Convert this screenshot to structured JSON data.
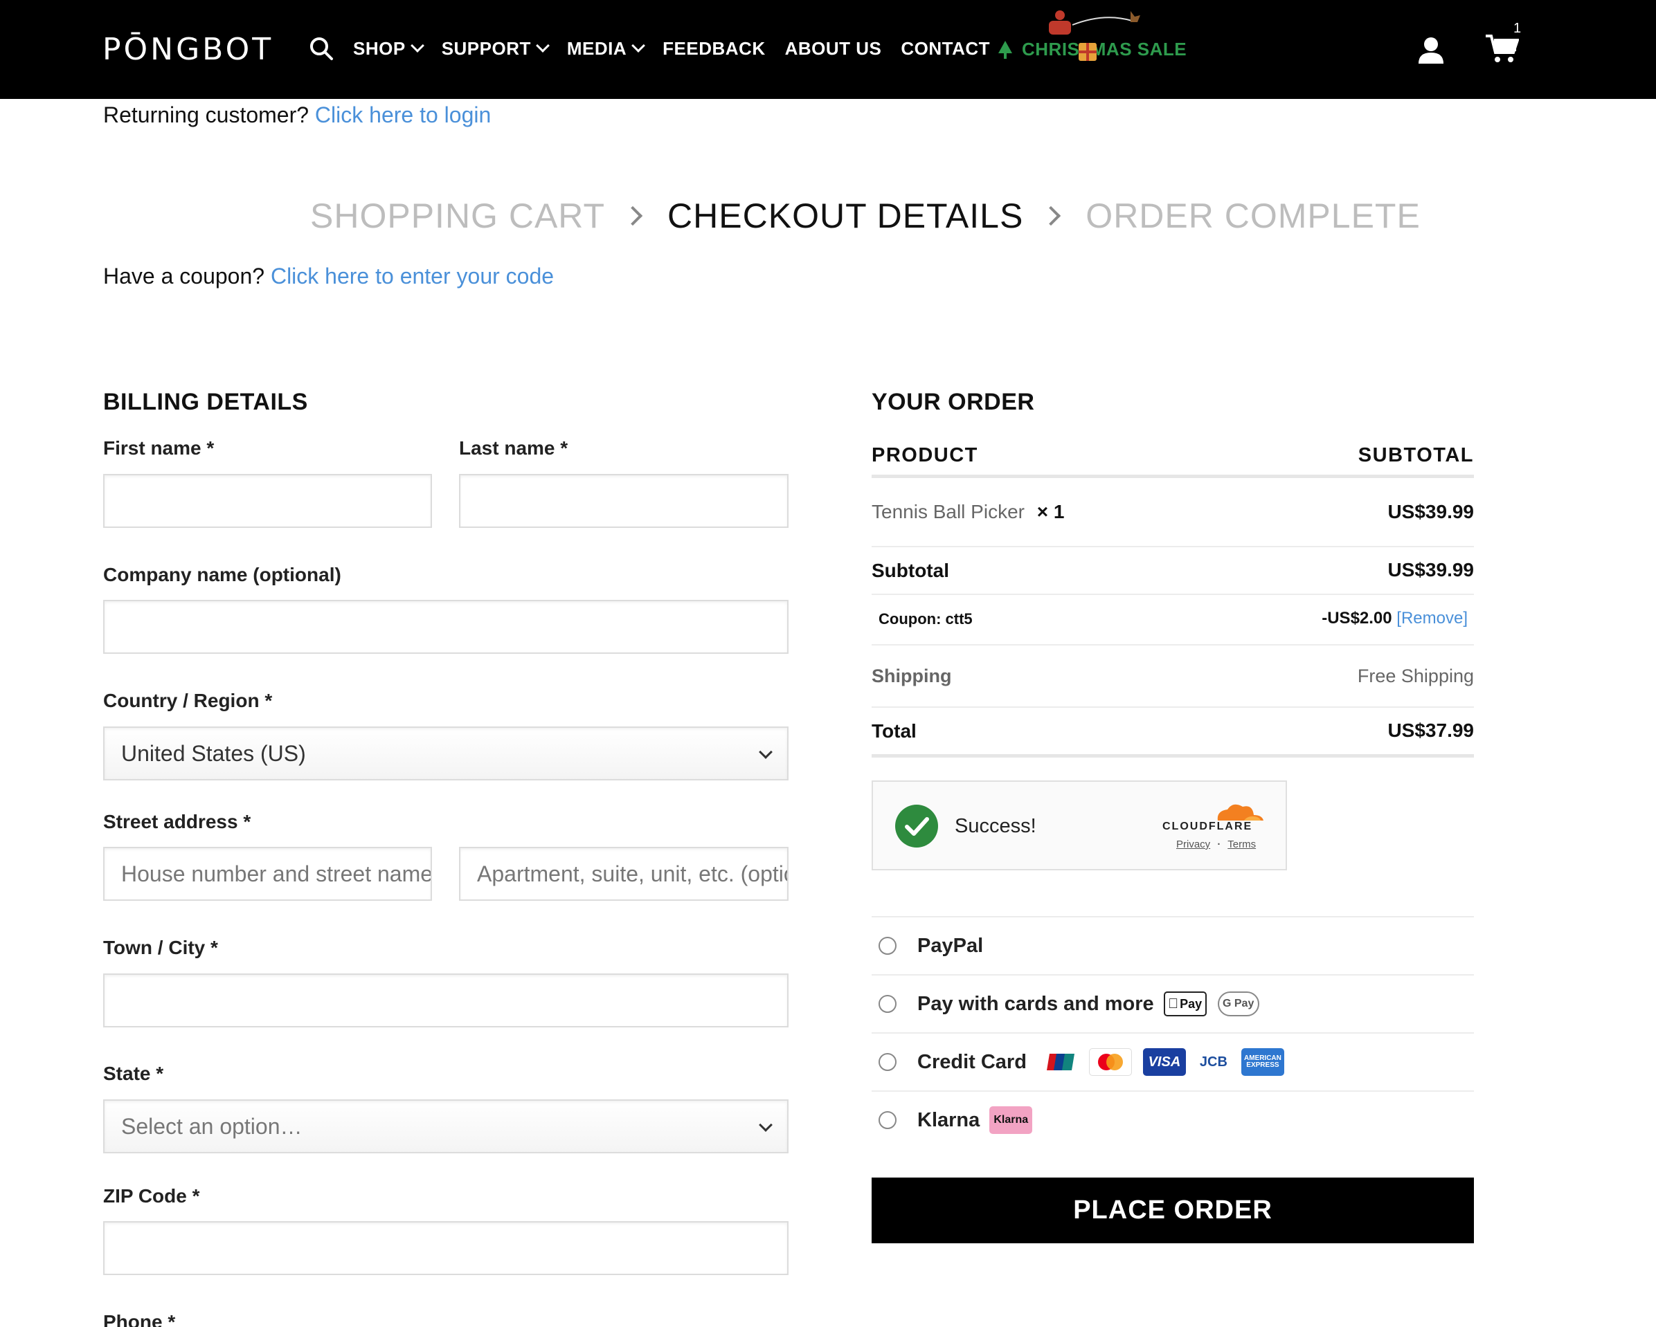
{
  "header": {
    "logo": "PŌNGBOT",
    "nav": [
      {
        "label": "SHOP",
        "dropdown": true
      },
      {
        "label": "SUPPORT",
        "dropdown": true
      },
      {
        "label": "MEDIA",
        "dropdown": true
      },
      {
        "label": "FEEDBACK",
        "dropdown": false
      },
      {
        "label": "ABOUT US",
        "dropdown": false
      },
      {
        "label": "CONTACT",
        "dropdown": false
      }
    ],
    "promo": "CHRISTMAS SALE",
    "cart_count": "1",
    "colors": {
      "bar": "#000000",
      "promo": "#2e9b4d"
    }
  },
  "notices": {
    "returning_text": "Returning customer?",
    "returning_link": "Click here to login",
    "coupon_text": "Have a coupon?",
    "coupon_link": "Click here to enter your code",
    "link_color": "#4a90d9"
  },
  "steps": {
    "items": [
      "SHOPPING CART",
      "CHECKOUT DETAILS",
      "ORDER COMPLETE"
    ],
    "active": "CHECKOUT DETAILS"
  },
  "billing": {
    "title": "BILLING DETAILS",
    "first_name_label": "First name *",
    "last_name_label": "Last name *",
    "company_label": "Company name (optional)",
    "country_label": "Country / Region *",
    "country_value": "United States (US)",
    "street_label": "Street address *",
    "street_placeholder": "House number and street name",
    "apartment_placeholder": "Apartment, suite, unit, etc. (optional)",
    "city_label": "Town / City *",
    "state_label": "State *",
    "state_placeholder": "Select an option…",
    "zip_label": "ZIP Code *",
    "phone_label": "Phone *"
  },
  "order": {
    "title": "YOUR ORDER",
    "col_product": "PRODUCT",
    "col_subtotal": "SUBTOTAL",
    "item_name": "Tennis Ball Picker",
    "item_qty": "× 1",
    "item_price": "US$39.99",
    "subtotal_label": "Subtotal",
    "subtotal_value": "US$39.99",
    "coupon_label": "Coupon: ctt5",
    "coupon_value": "-US$2.00",
    "coupon_remove": "[Remove]",
    "shipping_label": "Shipping",
    "shipping_value": "Free Shipping",
    "total_label": "Total",
    "total_value": "US$37.99"
  },
  "captcha": {
    "status": "Success!",
    "brand": "CLOUDFLARE",
    "privacy": "Privacy",
    "separator": "·",
    "terms": "Terms"
  },
  "payment": {
    "paypal": "PayPal",
    "cards_more": "Pay with cards and more",
    "apple_pay": "Pay",
    "google_pay": "G Pay",
    "credit_card": "Credit Card",
    "visa": "VISA",
    "jcb": "JCB",
    "amex": "AMERICAN EXPRESS",
    "klarna": "Klarna",
    "klarna_badge": "Klarna"
  },
  "place_order": "PLACE ORDER"
}
